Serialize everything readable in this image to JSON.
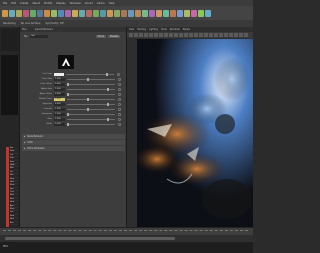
{
  "menubar": {
    "items": [
      "File",
      "Edit",
      "Create",
      "Select",
      "Modify",
      "Display",
      "Windows",
      "Arnold",
      "Cache",
      "Help"
    ]
  },
  "statusline": {
    "items": [
      "Rendering",
      "No Live Surface",
      "Symmetry: Off"
    ]
  },
  "attribute_editor": {
    "tabs": [
      "file1",
      "place2dTexture1"
    ],
    "name_label": "file:",
    "name_value": "file1",
    "focus_label": "Focus",
    "presets_label": "Presets",
    "show_label": "Show",
    "hide_label": "Hide",
    "attributes": [
      {
        "label": "Out Color",
        "value": ""
      },
      {
        "label": "Color Gain",
        "value": "1.000"
      },
      {
        "label": "Color Offset",
        "value": "0.000"
      },
      {
        "label": "Alpha Gain",
        "value": "1.000"
      },
      {
        "label": "Alpha Offset",
        "value": "0.000"
      },
      {
        "label": "Default Color",
        "value": "0.500"
      },
      {
        "label": "Exposure",
        "value": "0.000"
      },
      {
        "label": "Contrast",
        "value": "1.000"
      },
      {
        "label": "Saturation",
        "value": "1.000"
      },
      {
        "label": "Gain",
        "value": "1.000"
      },
      {
        "label": "Offset",
        "value": "0.000"
      }
    ],
    "sections": [
      "Node Behavior",
      "UUID",
      "Extra Attributes"
    ]
  },
  "panel": {
    "title": "persp",
    "menu": [
      "View",
      "Shading",
      "Lighting",
      "Show",
      "Renderer",
      "Panels"
    ]
  },
  "outliner": {
    "rows": [
      "Sta",
      "Swo",
      "Iva",
      "Sna",
      "Ima",
      "Gwb",
      "Mla",
      "Ter",
      "Fbs",
      "Swa",
      "Gav",
      "Rmo",
      "Iwa",
      "Tna",
      "Sbo",
      "Sha",
      "Hea",
      "Ava",
      "Mrm",
      "Iva",
      "Swa",
      "Hea",
      "Bm"
    ]
  },
  "commandline": {
    "label": "MEL"
  },
  "colors": {
    "accent": "#c4352e",
    "highlight": "#d8c86a",
    "bg": "#2b2b2b"
  }
}
